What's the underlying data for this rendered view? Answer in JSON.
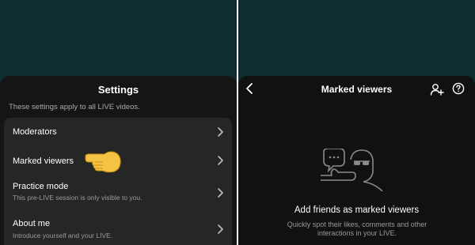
{
  "settings": {
    "title": "Settings",
    "subtitle": "These settings apply to all LIVE videos.",
    "items": [
      {
        "label": "Moderators",
        "description": ""
      },
      {
        "label": "Marked viewers",
        "description": ""
      },
      {
        "label": "Practice mode",
        "description": "This pre-LIVE session is only visible to you."
      },
      {
        "label": "About me",
        "description": "Introduce yourself and your LIVE."
      }
    ]
  },
  "marked_viewers": {
    "title": "Marked viewers",
    "empty_title": "Add friends as marked viewers",
    "empty_description": "Quickly spot their likes, comments and other interactions in your LIVE."
  },
  "icons": {
    "back": "chevron-left-icon",
    "add_user": "add-user-icon",
    "help": "question-circle-icon",
    "row_chevron": "chevron-right-icon",
    "pointer": "pointing-hand-emoji",
    "empty_state": "viewers-illustration"
  },
  "colors": {
    "background_teal": "#0f2c31",
    "sheet": "#151515",
    "card": "#262626",
    "text_primary": "#ffffff",
    "text_secondary": "#9a9a9a"
  }
}
